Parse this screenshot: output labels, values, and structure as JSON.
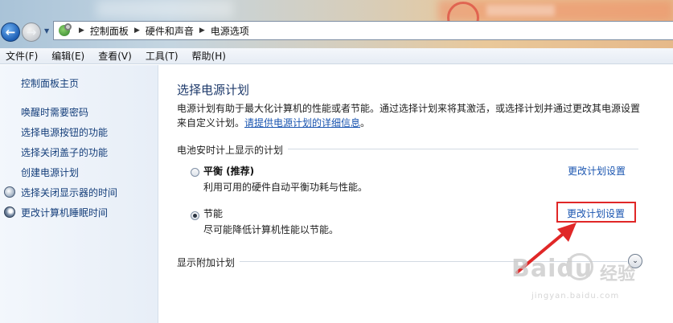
{
  "breadcrumb": [
    "控制面板",
    "硬件和声音",
    "电源选项"
  ],
  "menu": [
    "文件(F)",
    "编辑(E)",
    "查看(V)",
    "工具(T)",
    "帮助(H)"
  ],
  "sidebar": {
    "home": "控制面板主页",
    "links": [
      "唤醒时需要密码",
      "选择电源按钮的功能",
      "选择关闭盖子的功能",
      "创建电源计划",
      "选择关闭显示器的时间",
      "更改计算机睡眠时间"
    ]
  },
  "main": {
    "title": "选择电源计划",
    "desc_line1": "电源计划有助于最大化计算机的性能或者节能。通过选择计划来将其激活，或选择计划并通过更改其电源设置",
    "desc_line2_prefix": "来自定义计划。",
    "desc_link": "请提供电源计划的详细信息",
    "desc_line2_suffix": "。",
    "group_title": "电池安时计上显示的计划",
    "plans": [
      {
        "name": "平衡 (推荐)",
        "desc": "利用可用的硬件自动平衡功耗与性能。",
        "link": "更改计划设置",
        "selected": false
      },
      {
        "name": "节能",
        "desc": "尽可能降低计算机性能以节能。",
        "link": "更改计划设置",
        "selected": true
      }
    ],
    "more_title": "显示附加计划"
  },
  "watermark": {
    "logo": "Baidu",
    "sub": "经验",
    "url": "jingyan.baidu.com"
  },
  "colors": {
    "link": "#1a55b0",
    "sidebar_link": "#143e7a",
    "annotation": "#e02727"
  }
}
